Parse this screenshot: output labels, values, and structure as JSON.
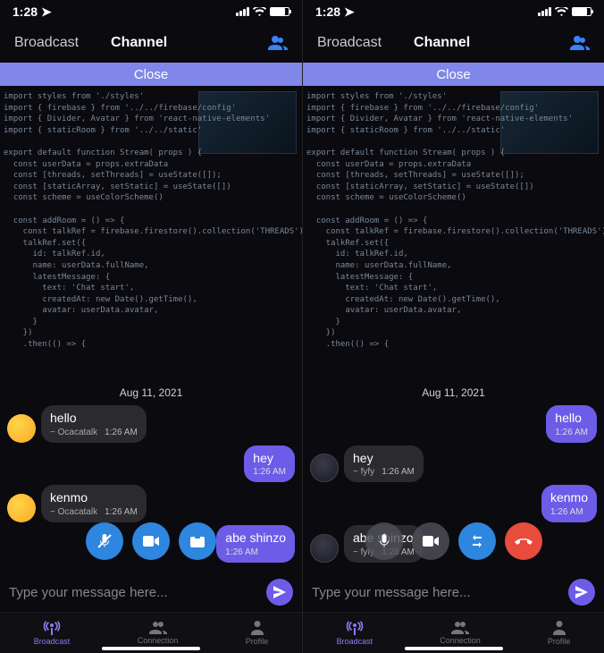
{
  "status": {
    "time": "1:28",
    "location_icon": "◀"
  },
  "header": {
    "tab_broadcast": "Broadcast",
    "tab_channel": "Channel"
  },
  "close_bar": "Close",
  "date": "Aug 11, 2021",
  "left_messages": [
    {
      "text": "hello",
      "from": "~ Ocacatalk",
      "time": "1:26 AM",
      "side": "left",
      "avatar": "gold"
    },
    {
      "text": "hey",
      "time": "1:26 AM",
      "side": "right"
    },
    {
      "text": "kenmo",
      "from": "~ Ocacatalk",
      "time": "1:26 AM",
      "side": "left",
      "avatar": "gold"
    },
    {
      "text": "abe shinzo",
      "time": "1:26 AM",
      "side": "right"
    }
  ],
  "right_messages": [
    {
      "text": "hello",
      "time": "1:26 AM",
      "side": "right"
    },
    {
      "text": "hey",
      "from": "~ fyfy",
      "time": "1:26 AM",
      "side": "left",
      "avatar": "dark"
    },
    {
      "text": "kenmo",
      "time": "1:26 AM",
      "side": "right"
    },
    {
      "text": "abe shinzo",
      "from": "~ fyfy",
      "time": "1:26 AM",
      "side": "left",
      "avatar": "dark"
    }
  ],
  "input": {
    "placeholder": "Type your message here..."
  },
  "tabs": {
    "broadcast": "Broadcast",
    "connection": "Connection",
    "profile": "Profile"
  },
  "code_lines": "import styles from './styles'\nimport { firebase } from '../../firebase/config'\nimport { Divider, Avatar } from 'react-native-elements'\nimport { staticRoom } from '../../static'\n\nexport default function Stream( props ) {\n  const userData = props.extraData\n  const [threads, setThreads] = useState([]);\n  const [staticArray, setStatic] = useState([])\n  const scheme = useColorScheme()\n\n  const addRoom = () => {\n    const talkRef = firebase.firestore().collection('THREADS')\n    talkRef.set({\n      id: talkRef.id,\n      name: userData.fullName,\n      latestMessage: {\n        text: 'Chat start',\n        createdAt: new Date().getTime(),\n        avatar: userData.avatar,\n      }\n    })\n    .then(() => {\n"
}
